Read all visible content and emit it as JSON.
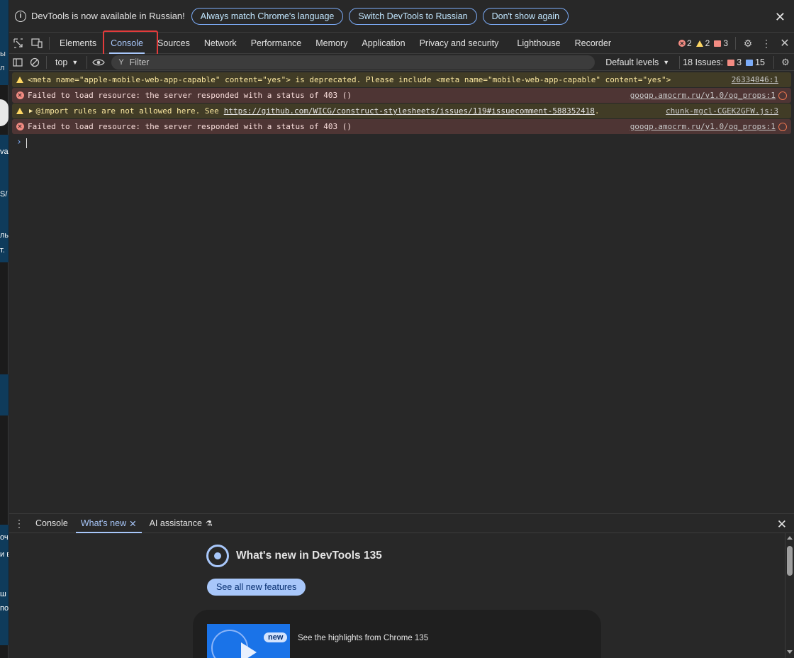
{
  "infobar": {
    "text": "DevTools is now available in Russian!",
    "buttons": [
      "Always match Chrome's language",
      "Switch DevTools to Russian",
      "Don't show again"
    ]
  },
  "tabs": {
    "items": [
      "Elements",
      "Console",
      "Sources",
      "Network",
      "Performance",
      "Memory",
      "Application",
      "Privacy and security",
      "Lighthouse",
      "Recorder"
    ],
    "active": "Console",
    "errors": "2",
    "warnings": "2",
    "issues": "3"
  },
  "console_toolbar": {
    "context": "top",
    "filter_placeholder": "Filter",
    "levels": "Default levels",
    "issues_label": "18 Issues:",
    "issues_errors": "3",
    "issues_info": "15"
  },
  "messages": [
    {
      "level": "warning",
      "text": "<meta name=\"apple-mobile-web-app-capable\" content=\"yes\"> is deprecated. Please include <meta name=\"mobile-web-app-capable\" content=\"yes\">",
      "source": "26334846:1"
    },
    {
      "level": "error",
      "text": "Failed to load resource: the server responded with a status of 403 ()",
      "source": "googp.amocrm.ru/v1.0/og_props:1"
    },
    {
      "level": "warning",
      "text_prefix": "@import rules are not allowed here. See ",
      "link": "https://github.com/WICG/construct-stylesheets/issues/119#issuecomment-588352418",
      "text_suffix": ".",
      "source": "chunk-mgcl-CGEK2GFW.js:3"
    },
    {
      "level": "error",
      "text": "Failed to load resource: the server responded with a status of 403 ()",
      "source": "googp.amocrm.ru/v1.0/og_props:1"
    }
  ],
  "drawer": {
    "tabs": [
      "Console",
      "What's new",
      "AI assistance"
    ],
    "active": "What's new",
    "title": "What's new in DevTools 135",
    "see_all": "See all new features",
    "card_badge": "new",
    "card_text": "See the highlights from Chrome 135"
  },
  "page_strip": {
    "fragments": [
      "ы",
      "л",
      "va",
      "S/",
      "лы",
      "т.",
      "оч",
      "и в",
      "ш",
      "по"
    ]
  },
  "colors": {
    "accent": "#a8c7fa",
    "error": "#f28b82",
    "warning": "#fdd663",
    "highlight": "#e33b3b"
  }
}
